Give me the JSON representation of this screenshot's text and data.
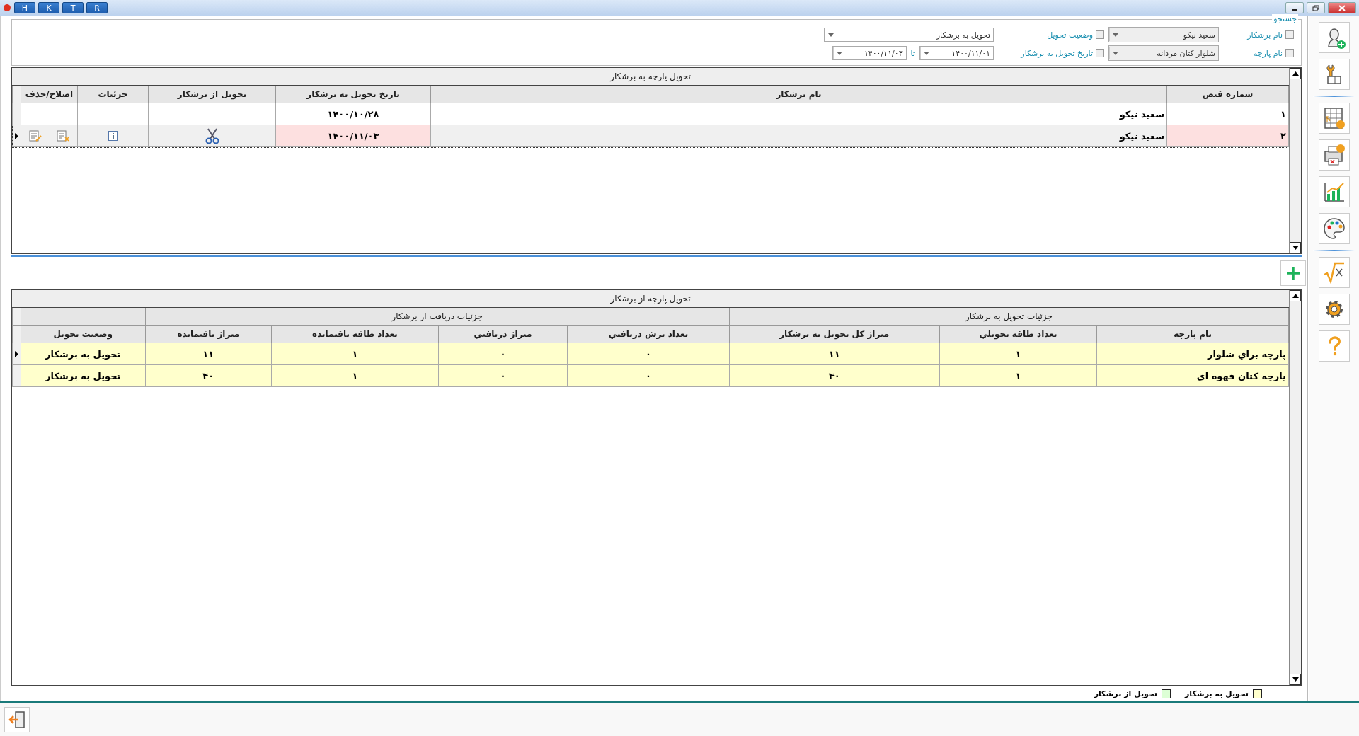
{
  "title_bar": {
    "buttons": [
      "R",
      "T",
      "K",
      "H"
    ]
  },
  "search": {
    "legend": "جستجو",
    "filters": [
      {
        "label": "نام برشکار",
        "checked": false,
        "value": "سعید نیکو"
      },
      {
        "label": "نام پارچه",
        "checked": false,
        "value": "شلوار کتان مردانه"
      }
    ],
    "status_filter": {
      "label": "وضعیت تحویل",
      "checked": false,
      "value": "تحویل به برشکار"
    },
    "date_filter": {
      "label": "تاریخ تحویل به برشکار",
      "checked": false,
      "from": "۱۴۰۰/۱۱/۰۱",
      "to_label": "تا",
      "to": "۱۴۰۰/۱۱/۰۳"
    }
  },
  "top_grid": {
    "caption": "تحویل پارچه به برشکار",
    "columns": [
      "شماره قبض",
      "نام برشکار",
      "تاریخ تحویل به برشکار",
      "تحویل از برشکار",
      "جزئیات",
      "اصلاح/حذف"
    ],
    "rows": [
      {
        "receipt": "۱",
        "cutter": "سعید نیکو",
        "date": "۱۴۰۰/۱۰/۲۸",
        "selected": false,
        "actions_shown": false
      },
      {
        "receipt": "۲",
        "cutter": "سعید نیکو",
        "date": "۱۴۰۰/۱۱/۰۳",
        "selected": true,
        "actions_shown": true
      }
    ]
  },
  "bottom_grid": {
    "caption": "تحویل پارچه از برشکار",
    "column_groups": [
      {
        "title": "جزئیات تحویل به برشکار",
        "columns": [
          "نام پارچه",
          "تعداد طاقه تحویلي",
          "متراژ کل تحویل به برشکار"
        ]
      },
      {
        "title": "جزئیات دریافت از برشکار",
        "columns": [
          "تعداد برش دریافتي",
          "متراژ دریافتي",
          "تعداد طاقه باقیمانده",
          "متراژ باقیمانده"
        ]
      },
      {
        "columns": [
          "وضعیت تحویل"
        ]
      }
    ],
    "rows": [
      {
        "cells": [
          "پارچه براي شلوار",
          "۱",
          "۱۱",
          "۰",
          "۰",
          "۱",
          "۱۱",
          "تحویل به برشکار"
        ],
        "selected": true,
        "color": "#ffffcc"
      },
      {
        "cells": [
          "پارچه کتان قهوه اي",
          "۱",
          "۴۰",
          "۰",
          "۰",
          "۱",
          "۴۰",
          "تحویل به برشکار"
        ],
        "selected": false,
        "color": "#ffffcc"
      }
    ]
  },
  "legend": [
    {
      "label": "تحویل به برشکار",
      "color": "#ffffcc"
    },
    {
      "label": "تحویل از برشکار",
      "color": "#ddffd6"
    }
  ]
}
